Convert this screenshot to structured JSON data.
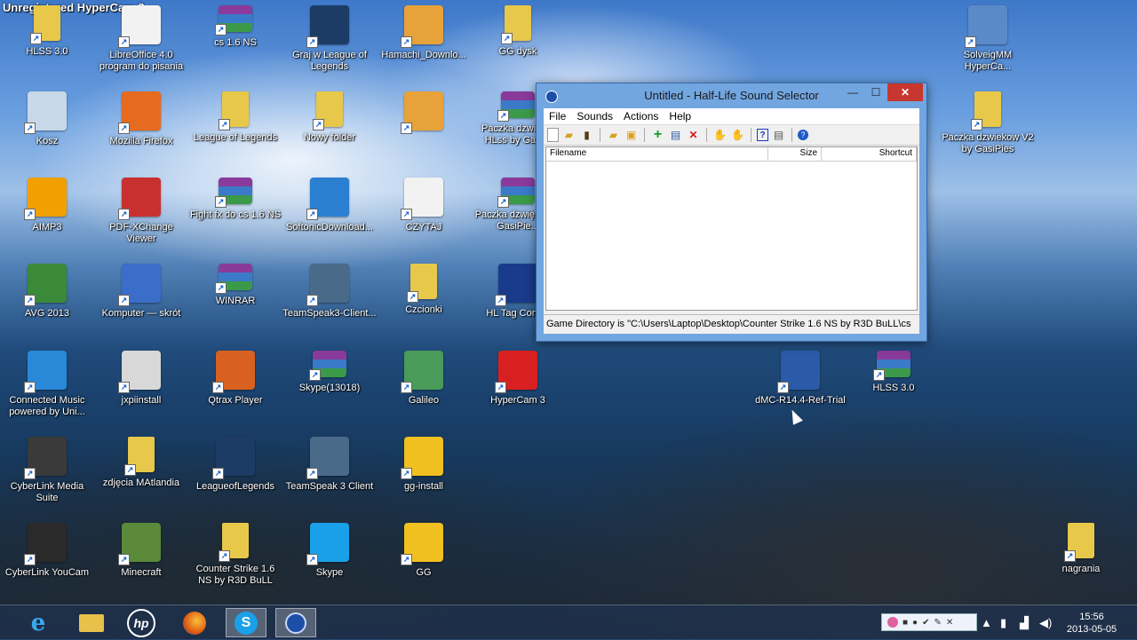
{
  "watermark": "Unregistered HyperCam 3",
  "desktop_icons": [
    {
      "label": "HLSS 3.0",
      "icon": "folder-icon",
      "color": "#e8c84a"
    },
    {
      "label": "LibreOffice 4.0 program do pisania",
      "icon": "document-icon",
      "color": "#f2f2f2"
    },
    {
      "label": "cs 1.6 NS",
      "icon": "winrar-icon",
      "color": "#7b3a8c"
    },
    {
      "label": "Graj w League of Legends",
      "icon": "lol-icon",
      "color": "#1c3c66"
    },
    {
      "label": "Hamachi_Downlo...",
      "icon": "hamachi-icon",
      "color": "#e8a23a"
    },
    {
      "label": "GG dysk",
      "icon": "gg-folder-icon",
      "color": "#e8c84a"
    },
    {
      "label": "Kosz",
      "icon": "recycle-bin-icon",
      "color": "#c8d8e8"
    },
    {
      "label": "Mozilla Firefox",
      "icon": "firefox-icon",
      "color": "#e66a1f"
    },
    {
      "label": "League of Legends",
      "icon": "folder-icon",
      "color": "#e8c84a"
    },
    {
      "label": "Nowy folder",
      "icon": "folder-icon",
      "color": "#e8c84a"
    },
    {
      "label": "",
      "icon": "hamachi-icon",
      "color": "#e8a23a"
    },
    {
      "label": "Paczka dzwięk... HLss by Gasi...",
      "icon": "winrar-icon",
      "color": "#7b3a8c"
    },
    {
      "label": "AIMP3",
      "icon": "aimp-icon",
      "color": "#f0a000"
    },
    {
      "label": "PDF-XChange Viewer",
      "icon": "pdf-icon",
      "color": "#c83030"
    },
    {
      "label": "Fight fx do cs 1.6 NS",
      "icon": "winrar-icon",
      "color": "#7b3a8c"
    },
    {
      "label": "SoftonicDownload...",
      "icon": "softonic-icon",
      "color": "#2a7fd0"
    },
    {
      "label": "CZYTAJ",
      "icon": "text-file-icon",
      "color": "#f2f2f2"
    },
    {
      "label": "Paczka dzwięk... by GasiPie...",
      "icon": "winrar-icon",
      "color": "#7b3a8c"
    },
    {
      "label": "AVG 2013",
      "icon": "avg-icon",
      "color": "#3a8a3a"
    },
    {
      "label": "Komputer — skrót",
      "icon": "computer-icon",
      "color": "#3a6ec8"
    },
    {
      "label": "WINRAR",
      "icon": "winrar-king-icon",
      "color": "#d8a020"
    },
    {
      "label": "TeamSpeak3-Client...",
      "icon": "teamspeak-icon",
      "color": "#4a6a8a"
    },
    {
      "label": "Czcionki",
      "icon": "folder-icon",
      "color": "#e8c84a"
    },
    {
      "label": "HL Tag Conv...",
      "icon": "halflife-icon",
      "color": "#1a3a8a"
    },
    {
      "label": "Connected Music powered by Uni...",
      "icon": "music-icon",
      "color": "#2a88d8"
    },
    {
      "label": "jxpiinstall",
      "icon": "java-icon",
      "color": "#d8d8d8"
    },
    {
      "label": "Qtrax Player",
      "icon": "qtrax-icon",
      "color": "#d86020"
    },
    {
      "label": "Skype(13018)",
      "icon": "winrar-king-icon",
      "color": "#d8a020"
    },
    {
      "label": "Galileo",
      "icon": "galileo-icon",
      "color": "#4a9a5a"
    },
    {
      "label": "HyperCam 3",
      "icon": "hypercam-icon",
      "color": "#d82020"
    },
    {
      "label": "dMC-R14.4-Ref-Trial",
      "icon": "dmc-icon",
      "color": "#2a5aa8"
    },
    {
      "label": "HLSS 3.0",
      "icon": "winrar-icon",
      "color": "#7b3a8c"
    },
    {
      "label": "CyberLink Media Suite",
      "icon": "cyberlink-icon",
      "color": "#3a3a3a"
    },
    {
      "label": "zdjęcia MAtlandia",
      "icon": "folder-icon",
      "color": "#e8c84a"
    },
    {
      "label": "LeagueofLegends",
      "icon": "lol-icon",
      "color": "#1c3c66"
    },
    {
      "label": "TeamSpeak 3 Client",
      "icon": "teamspeak-icon",
      "color": "#4a6a8a"
    },
    {
      "label": "gg-install",
      "icon": "gg-icon",
      "color": "#f0c020"
    },
    {
      "label": "CyberLink YouCam",
      "icon": "youcam-icon",
      "color": "#2a2a2a"
    },
    {
      "label": "Minecraft",
      "icon": "minecraft-icon",
      "color": "#5a8a3a"
    },
    {
      "label": "Counter Strike 1.6 NS by R3D BuLL",
      "icon": "folder-icon",
      "color": "#e8c84a"
    },
    {
      "label": "Skype",
      "icon": "skype-icon",
      "color": "#1aa0e8"
    },
    {
      "label": "GG",
      "icon": "gg-icon",
      "color": "#f0c020"
    },
    {
      "label": "SolveigMM HyperCa...",
      "icon": "solveig-icon",
      "color": "#5a8ac8"
    },
    {
      "label": "Paczka dzwiekow V2 by GasiPies",
      "icon": "folder-icon",
      "color": "#e8c84a"
    },
    {
      "label": "nagrania",
      "icon": "folder-icon",
      "color": "#e8c84a"
    }
  ],
  "window": {
    "title": "Untitled - Half-Life Sound Selector",
    "minimize": "—",
    "maximize": "☐",
    "close": "✕",
    "menu": [
      "File",
      "Sounds",
      "Actions",
      "Help"
    ],
    "columns": [
      "Filename",
      "Size",
      "Shortcut"
    ],
    "status": "Game Directory is \"C:\\Users\\Laptop\\Desktop\\Counter Strike 1.6 NS by R3D BuLL\\cs"
  },
  "taskbar": {
    "clock_time": "15:56",
    "clock_date": "2013-05-05"
  }
}
